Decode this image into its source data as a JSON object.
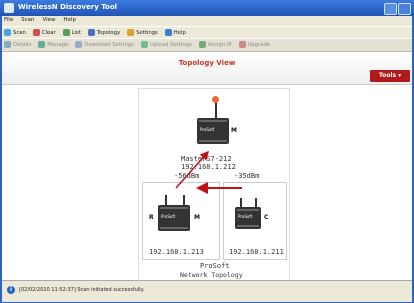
{
  "window": {
    "title": "WirelessN Discovery Tool"
  },
  "menu": [
    "File",
    "Scan",
    "View",
    "Help"
  ],
  "toolbar1": [
    "Scan",
    "Clear",
    "List",
    "Topology",
    "Settings",
    "Help"
  ],
  "toolbar2": [
    "Details",
    "Manage",
    "Download Settings",
    "Upload Settings",
    "Assign IP",
    "Upgrade"
  ],
  "topology": {
    "title": "Topology View",
    "tools_label": "Tools",
    "master": {
      "name": "MasterS7-212",
      "ip": "192.168.1.212",
      "role": "M"
    },
    "links": {
      "left_dbm": "-56dBm",
      "right_dbm": "-35dBm"
    },
    "repeater": {
      "ip": "192.168.1.213",
      "role_left": "R",
      "role_right": "M"
    },
    "client": {
      "ip": "192.168.1.211",
      "role": "C"
    },
    "footer_company": "ProSoft",
    "footer_caption": "Network Topology"
  },
  "status": {
    "message": "[02/02/2010 11:52:37] Scan initiated successfully."
  }
}
